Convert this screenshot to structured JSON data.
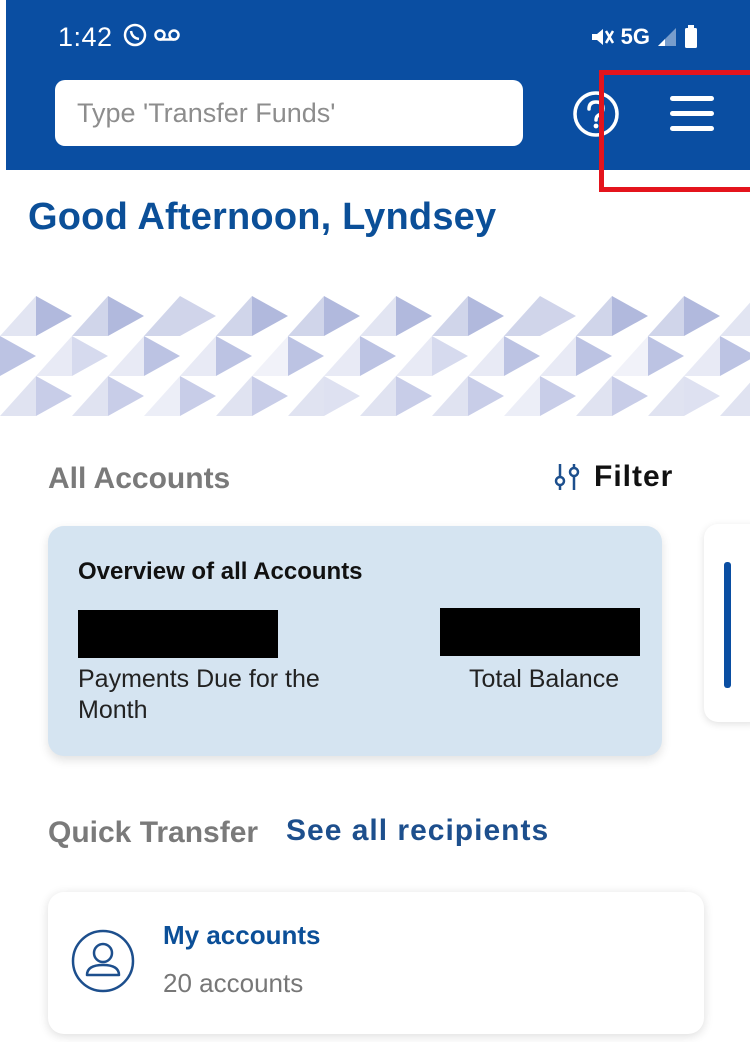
{
  "status_bar": {
    "time": "1:42",
    "network": "5G",
    "icons": [
      "whatsapp-icon",
      "voicemail-icon",
      "mute-icon",
      "signal-icon",
      "battery-icon"
    ]
  },
  "header": {
    "search_placeholder": "Type 'Transfer Funds'",
    "help_icon": "question-circle-icon",
    "menu_icon": "hamburger-menu-icon",
    "color": "#0a4ea2",
    "highlight_color": "#e4141c"
  },
  "greeting": "Good Afternoon, Lyndsey",
  "accounts": {
    "section_label": "All Accounts",
    "filter_label": "Filter",
    "overview": {
      "title": "Overview of all Accounts",
      "payments_label": "Payments Due for the Month",
      "balance_label": "Total Balance"
    }
  },
  "quick_transfer": {
    "section_label": "Quick Transfer",
    "see_all_label": "See all recipients",
    "recipient": {
      "title": "My accounts",
      "subtitle": "20 accounts"
    }
  }
}
